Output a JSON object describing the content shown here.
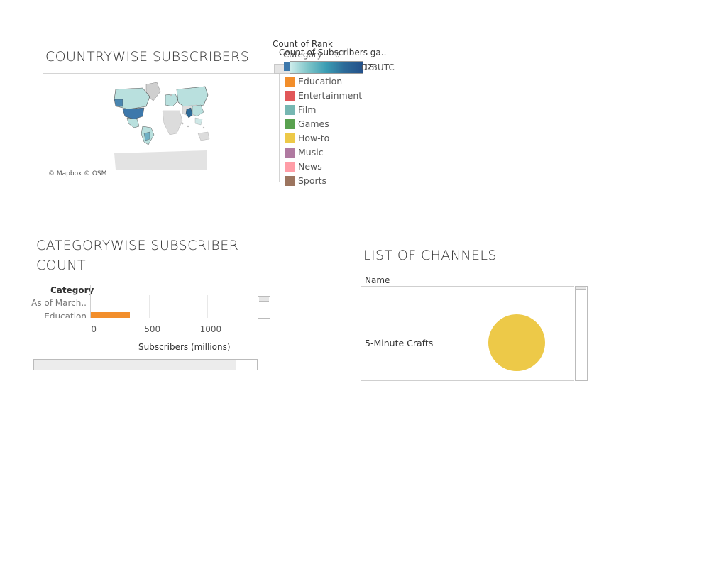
{
  "countrywise": {
    "title": "COUNTRYWISE SUBSCRIBERS",
    "attribution": "© Mapbox © OSM"
  },
  "legends": {
    "count_of_rank": "Count of Rank",
    "count_of_subscribers": "Count of Subscribers ga..",
    "colorbar_min": "0",
    "colorbar_max": "18",
    "overlapped_text": "023UTC",
    "category_title": "Category",
    "category_items": [
      {
        "label": "Education",
        "color": "#f28e2b"
      },
      {
        "label": "Entertainment",
        "color": "#e15759"
      },
      {
        "label": "Film",
        "color": "#76b7b2"
      },
      {
        "label": "Games",
        "color": "#59a14f"
      },
      {
        "label": "How-to",
        "color": "#edc948"
      },
      {
        "label": "Music",
        "color": "#b07aa1"
      },
      {
        "label": "News",
        "color": "#ff9da7"
      },
      {
        "label": "Sports",
        "color": "#9c755f"
      }
    ]
  },
  "categorywise": {
    "title_line1": "CATEGORYWISE SUBSCRIBER",
    "title_line2": "COUNT",
    "row_header": "Category",
    "rows": [
      "As of March..",
      "Education"
    ],
    "axis_title": "Subscribers (millions)",
    "ticks": [
      "0",
      "500",
      "1000"
    ]
  },
  "chart_data": {
    "type": "bar",
    "categories": [
      "Education"
    ],
    "values": [
      335
    ],
    "xlabel": "Subscribers (millions)",
    "xlim": [
      0,
      1450
    ],
    "color": "#f28e2b"
  },
  "channels": {
    "title": "LIST OF CHANNELS",
    "column_header": "Name",
    "rows": [
      {
        "name": "5-Minute Crafts",
        "category": "How-to",
        "color": "#edc948"
      }
    ]
  }
}
